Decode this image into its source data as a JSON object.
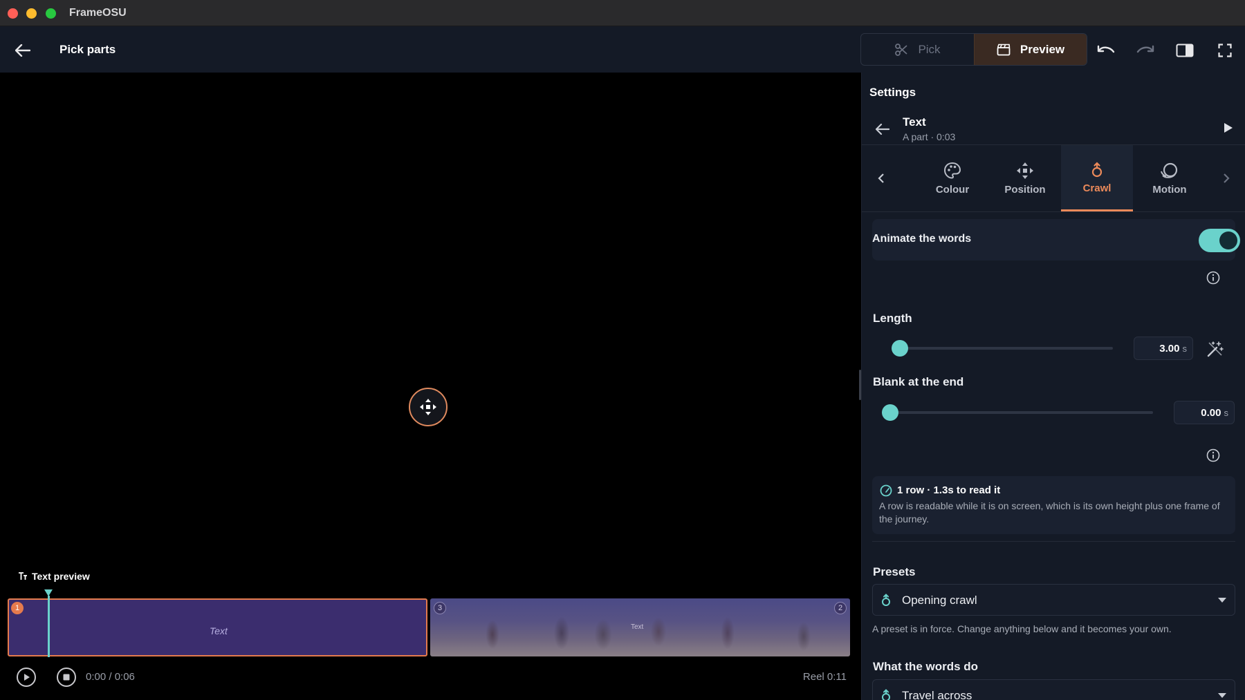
{
  "window": {
    "app_title": "FrameOSU"
  },
  "header": {
    "page_title": "Pick parts",
    "mode_pick_label": "Pick",
    "mode_preview_label": "Preview",
    "icons": [
      "back-arrow-icon",
      "scissors-icon",
      "clapperboard-icon",
      "undo-icon",
      "redo-icon",
      "side-panel-icon",
      "fullscreen-icon"
    ]
  },
  "timeline": {
    "track_label": "Text preview",
    "clip1": {
      "badge": "1",
      "text": "Text"
    },
    "clip2": {
      "badge_left": "3",
      "badge_right": "2",
      "text": "Text"
    },
    "timecode": "0:00 / 0:06",
    "reel": "Reel 0:11"
  },
  "settings": {
    "title": "Settings",
    "item_title": "Text",
    "item_subtitle": "A part · 0:03",
    "tabs": [
      {
        "label": "Colour",
        "icon": "palette-icon"
      },
      {
        "label": "Position",
        "icon": "move-icon"
      },
      {
        "label": "Crawl",
        "icon": "crawl-icon",
        "active": true
      },
      {
        "label": "Motion",
        "icon": "motion-icon"
      }
    ],
    "animate_label": "Animate the words",
    "animate_on": true,
    "length": {
      "label": "Length",
      "value": "3.00",
      "unit": "s",
      "fraction": 0.0
    },
    "blank": {
      "label": "Blank at the end",
      "value": "0.00",
      "unit": "s",
      "fraction": 0.0
    },
    "info_card": {
      "title": "1 row · 1.3s to read it",
      "body": "A row is readable while it is on screen, which is its own height plus one frame of the journey."
    },
    "presets": {
      "label": "Presets",
      "selected": "Opening crawl",
      "note": "A preset is in force. Change anything below and it becomes your own."
    },
    "words": {
      "label": "What the words do",
      "selected": "Travel across"
    }
  },
  "colors": {
    "accent": "#ec8a5a",
    "teal": "#6ad2cb",
    "panel": "#141a26",
    "clip": "#3b2d6e"
  }
}
